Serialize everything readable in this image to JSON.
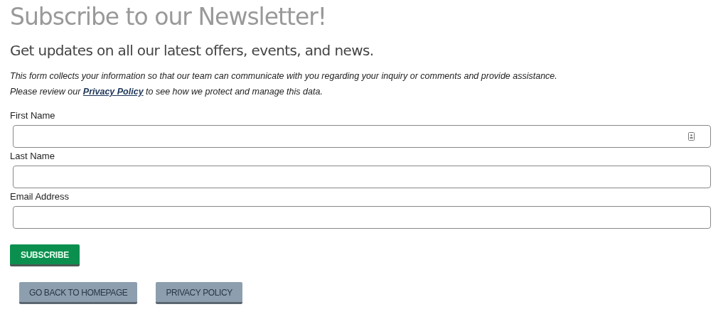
{
  "title": "Subscribe to our Newsletter!",
  "subtitle": "Get updates on all our latest offers, events, and news.",
  "intro": {
    "line_1": "This form collects your information so that our team can communicate with you regarding your inquiry or comments and provide assistance.",
    "line_2_before": "Please review our",
    "link": "Privacy Policy",
    "line_2_after": "to see how we protect and manage this data."
  },
  "fields": [
    {
      "label": "First Name",
      "kind": "autofill"
    },
    {
      "label": "Last Name",
      "kind": "plain"
    },
    {
      "label": "Email Address",
      "kind": "plain"
    }
  ],
  "submit": "SUBSCRIBE",
  "buttons": [
    "GO BACK TO HOMEPAGE",
    "PRIVACY POLICY"
  ]
}
